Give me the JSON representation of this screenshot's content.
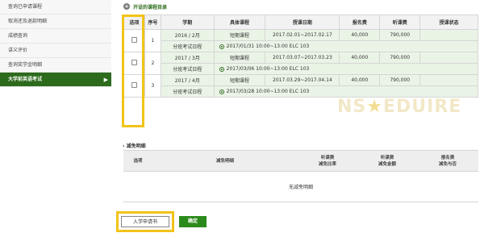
{
  "sidebar": {
    "items": [
      {
        "label": "查询已申请课程",
        "active": false
      },
      {
        "label": "取消还及退款明细",
        "active": false
      },
      {
        "label": "成绩查询",
        "active": false
      },
      {
        "label": "讲义评价",
        "active": false
      },
      {
        "label": "查询奖学金明细",
        "active": false
      },
      {
        "label": "大学前英语考试",
        "active": true
      }
    ],
    "active_arrow": "▶"
  },
  "main": {
    "section_title": "开设的课程目录",
    "plus_glyph": "+",
    "course_table": {
      "headers": [
        "选项",
        "序号",
        "学期",
        "具体课程",
        "授课日期",
        "报名费",
        "听课费",
        "授课状态"
      ],
      "exam_label": "分班考试日程",
      "rows": [
        {
          "no": "1",
          "term": "2016 / 2月",
          "course": "短期课程",
          "dates": "2017.02.01~2017.02.17",
          "reg_fee": "40,000",
          "tuition": "790,000",
          "status": "",
          "exam": "2017/01/31 10:00~13:00 ELC 103"
        },
        {
          "no": "2",
          "term": "2017 / 3月",
          "course": "短期课程",
          "dates": "2017.03.07~2017.03.23",
          "reg_fee": "40,000",
          "tuition": "790,000",
          "status": "",
          "exam": "2017/03/06 10:00~13:00 ELC 103"
        },
        {
          "no": "3",
          "term": "2017 / 4月",
          "course": "短期课程",
          "dates": "2017.03.29~2017.04.14",
          "reg_fee": "40,000",
          "tuition": "790,000",
          "status": "",
          "exam": "2017/03/28 10:00~13:00 ELC 103"
        }
      ]
    },
    "discount": {
      "title": "减免明细",
      "headers": [
        "选项",
        "减免明细",
        "听课费\n减免比率",
        "听课费\n减免金额",
        "报名费\n减免与否"
      ],
      "empty_text": "无减免明细"
    },
    "buttons": {
      "apply": "入学申请书",
      "confirm": "确定"
    },
    "watermark": "NS★EDUIRE"
  },
  "colors": {
    "accent_green": "#2c6b1c",
    "confirm_green": "#2c8a1c",
    "highlight_yellow": "#f2c318",
    "row_tint": "#eaf4e6"
  }
}
